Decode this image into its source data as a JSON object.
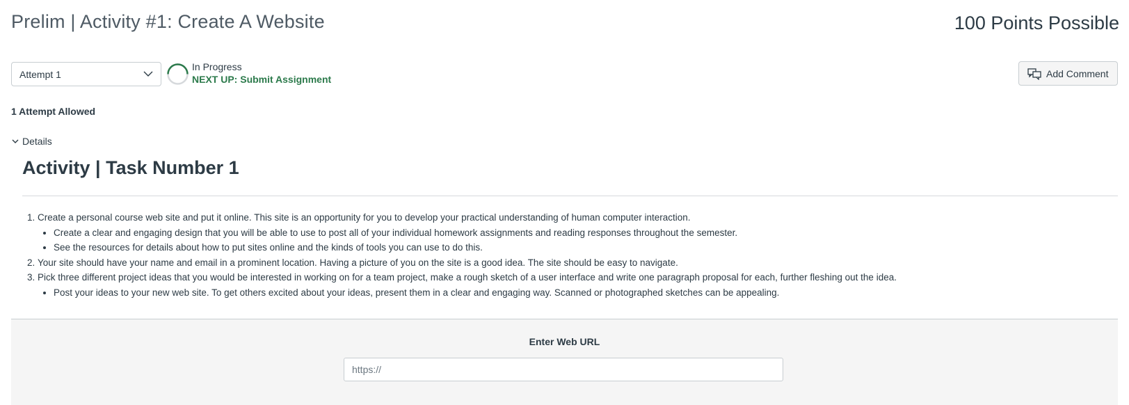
{
  "assignment": {
    "title": "Prelim | Activity #1: Create A Website",
    "points": "100 Points Possible"
  },
  "attempt": {
    "selected": "Attempt 1",
    "status": "In Progress",
    "next_up": "NEXT UP: Submit Assignment",
    "allowed": "1 Attempt Allowed"
  },
  "actions": {
    "add_comment": "Add Comment"
  },
  "details": {
    "toggle_label": "Details",
    "heading": "Activity | Task Number 1",
    "items": [
      {
        "text": "Create a personal course web site and put it online. This site is an opportunity for you to develop your practical understanding of human computer interaction.",
        "subitems": [
          "Create a clear and engaging design that you will be able to use to post all of your individual homework assignments and reading responses throughout the semester.",
          "See the resources for details about how to put sites online and the kinds of tools you can use to do this."
        ]
      },
      {
        "text": "Your site should have your name and email in a prominent location. Having a picture of you on the site is a good idea. The site should be easy to navigate.",
        "subitems": []
      },
      {
        "text": "Pick three different project ideas that you would be interested in working on for a team project, make a rough sketch of a user interface and write one paragraph proposal for each, further fleshing out the idea.",
        "subitems": [
          "Post your ideas to your new web site. To get others excited about your ideas, present them in a clear and engaging way. Scanned or photographed sketches can be appealing."
        ]
      }
    ]
  },
  "submission": {
    "label": "Enter Web URL",
    "placeholder": "https://",
    "value": ""
  },
  "colors": {
    "accent_green": "#2c7a4b",
    "text": "#2d3b45",
    "panel_bg": "#f5f5f5",
    "border": "#c7cdd1"
  },
  "icons": [
    "chevron-down-icon",
    "progress-ring-icon",
    "comment-icon",
    "details-chevron-icon"
  ]
}
